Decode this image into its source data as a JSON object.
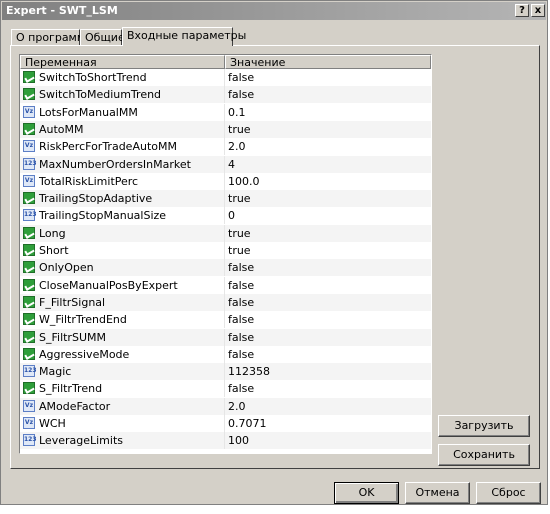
{
  "window": {
    "title": "Expert - SWT_LSM",
    "help_label": "?",
    "close_label": "x"
  },
  "tabs": [
    {
      "label": "О программе"
    },
    {
      "label": "Общие"
    },
    {
      "label": "Входные параметры"
    }
  ],
  "table": {
    "headers": {
      "name": "Переменная",
      "value": "Значение"
    },
    "rows": [
      {
        "name": "SwitchToShortTrend",
        "value": "false",
        "icon": "bool-icon"
      },
      {
        "name": "SwitchToMediumTrend",
        "value": "false",
        "icon": "bool-icon"
      },
      {
        "name": "LotsForManualMM",
        "value": "0.1",
        "icon": "double-icon"
      },
      {
        "name": "AutoMM",
        "value": "true",
        "icon": "bool-icon"
      },
      {
        "name": "RiskPercForTradeAutoMM",
        "value": "2.0",
        "icon": "double-icon"
      },
      {
        "name": "MaxNumberOrdersInMarket",
        "value": "4",
        "icon": "integer-icon"
      },
      {
        "name": "TotalRiskLimitPerc",
        "value": "100.0",
        "icon": "double-icon"
      },
      {
        "name": "TrailingStopAdaptive",
        "value": "true",
        "icon": "bool-icon"
      },
      {
        "name": "TrailingStopManualSize",
        "value": "0",
        "icon": "integer-icon"
      },
      {
        "name": "Long",
        "value": "true",
        "icon": "bool-icon"
      },
      {
        "name": "Short",
        "value": "true",
        "icon": "bool-icon"
      },
      {
        "name": "OnlyOpen",
        "value": "false",
        "icon": "bool-icon"
      },
      {
        "name": "CloseManualPosByExpert",
        "value": "false",
        "icon": "bool-icon"
      },
      {
        "name": "F_FiltrSignal",
        "value": "false",
        "icon": "bool-icon"
      },
      {
        "name": "W_FiltrTrendEnd",
        "value": "false",
        "icon": "bool-icon"
      },
      {
        "name": "S_FiltrSUMM",
        "value": "false",
        "icon": "bool-icon"
      },
      {
        "name": "AggressiveMode",
        "value": "false",
        "icon": "bool-icon"
      },
      {
        "name": "Magic",
        "value": "112358",
        "icon": "integer-icon"
      },
      {
        "name": "S_FiltrTrend",
        "value": "false",
        "icon": "bool-icon"
      },
      {
        "name": "AModeFactor",
        "value": "2.0",
        "icon": "double-icon"
      },
      {
        "name": "WCH",
        "value": "0.7071",
        "icon": "double-icon"
      },
      {
        "name": "LeverageLimits",
        "value": "100",
        "icon": "integer-icon"
      }
    ]
  },
  "side_buttons": {
    "load": "Загрузить",
    "save": "Сохранить"
  },
  "footer_buttons": {
    "ok": "OK",
    "cancel": "Отмена",
    "reset": "Сброс"
  }
}
